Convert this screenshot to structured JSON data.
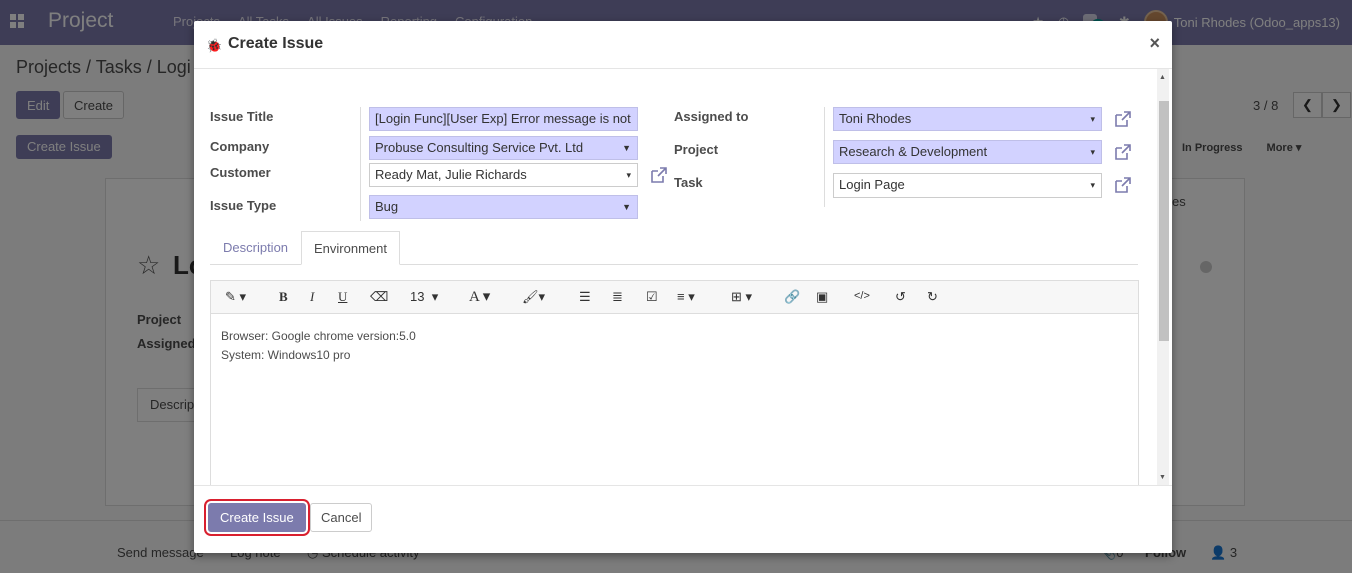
{
  "navbar": {
    "app_name": "Project",
    "menu": [
      "Projects",
      "All Tasks",
      "All Issues",
      "Reporting",
      "Configuration"
    ],
    "messages_count": "3",
    "user": "Toni Rhodes (Odoo_apps13)"
  },
  "background": {
    "breadcrumb": "Projects / Tasks / Logi",
    "edit_label": "Edit",
    "create_label": "Create",
    "create_issue_label": "Create Issue",
    "pager": "3 / 8",
    "status_in_progress": "In Progress",
    "status_more": "More",
    "sheet_title": "Lo",
    "project_label": "Project",
    "assigned_label": "Assigned",
    "description_tab": "Descrip",
    "right_partial": "es",
    "chatter": {
      "send_message": "Send message",
      "log_note": "Log note",
      "schedule_activity": "Schedule activity",
      "attachments": "0",
      "follow": "Follow",
      "followers": "3"
    }
  },
  "modal": {
    "title": "Create Issue",
    "close": "×",
    "labels": {
      "issue_title": "Issue Title",
      "company": "Company",
      "customer": "Customer",
      "issue_type": "Issue Type",
      "assigned_to": "Assigned to",
      "project": "Project",
      "task": "Task"
    },
    "values": {
      "issue_title": "[Login Func][User Exp] Error message is not",
      "company": "Probuse Consulting Service Pvt. Ltd",
      "customer": "Ready Mat, Julie Richards",
      "issue_type": "Bug",
      "assigned_to": "Toni Rhodes",
      "project": "Research & Development",
      "task": "Login Page"
    },
    "tabs": [
      "Description",
      "Environment"
    ],
    "active_tab": "Environment",
    "editor": {
      "font_size": "13",
      "lines": [
        "Browser: Google chrome version:5.0",
        "System: Windows10 pro"
      ]
    },
    "footer": {
      "create_issue": "Create Issue",
      "cancel": "Cancel"
    }
  },
  "colors": {
    "brand": "#7c7bad",
    "required_field": "#d2d2ff",
    "highlight_ring": "#d9202f"
  }
}
